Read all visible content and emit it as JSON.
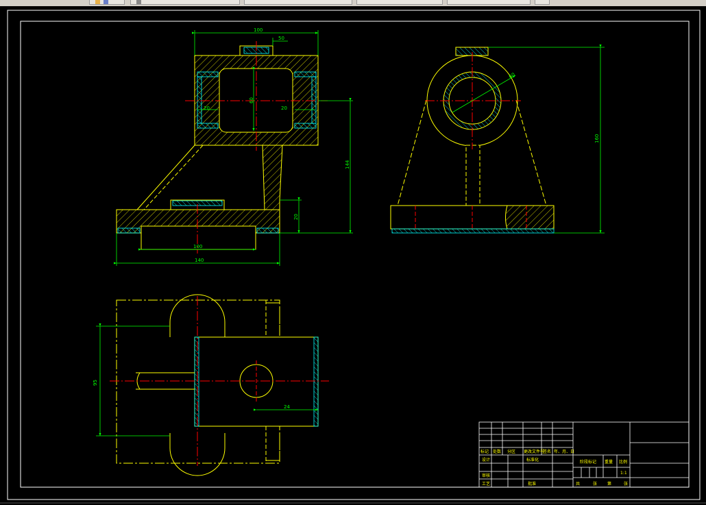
{
  "window": {
    "taskbar_buttons": [
      "",
      "",
      "",
      "",
      "",
      ""
    ]
  },
  "drawing": {
    "colors": {
      "background": "#000000",
      "outline": "#ffff00",
      "dimension": "#00ff00",
      "centerline": "#ff0000",
      "hatch": "#00ffff",
      "border": "#ffffff"
    },
    "dimensions": {
      "front_top_width": "100",
      "front_top_small": "50",
      "front_bore": "60",
      "front_wall_left": "20",
      "front_wall_right": "20",
      "front_total_height": "144",
      "front_base_height": "20",
      "front_base_slot": "100",
      "front_base_width": "140",
      "side_height": "160",
      "side_bore_dia": "60",
      "top_height": "95",
      "top_offset": "24"
    },
    "title_block": {
      "row_labels": [
        "标记",
        "处数",
        "分区",
        "更改文件号",
        "签名",
        "年、月、日"
      ],
      "design": "设计",
      "standardize": "标准化",
      "check": "审核",
      "process": "工艺",
      "approve": "批准",
      "stage_mark": "阶段标记",
      "weight": "重量",
      "scale": "比例",
      "scale_value": "1:1",
      "sheet_total": "共",
      "sheet_unit": "张",
      "sheet_no": "第",
      "sheet_unit2": "张"
    }
  }
}
